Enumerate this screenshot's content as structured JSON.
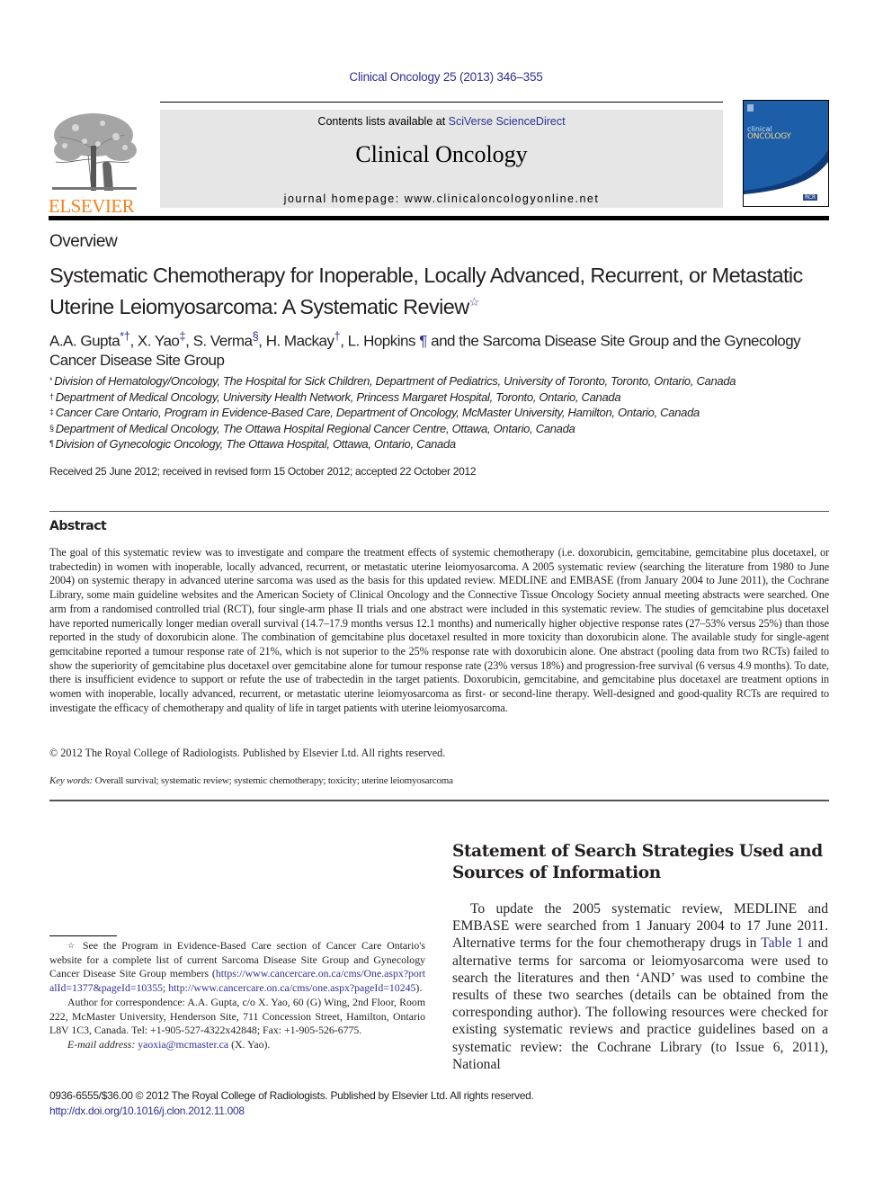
{
  "header": {
    "citation": "Clinical Oncology 25 (2013) 346–355",
    "contents_prefix": "Contents lists available at ",
    "contents_link": "SciVerse ScienceDirect",
    "journal_name": "Clinical Oncology",
    "homepage_label": "journal homepage: ",
    "homepage_url": "www.clinicaloncologyonline.net",
    "publisher_logo_text": "ELSEVIER",
    "cover": {
      "line1": "clinical",
      "line2": "ONCOLOGY",
      "badge": "RCR"
    }
  },
  "article": {
    "type": "Overview",
    "title": "Systematic Chemotherapy for Inoperable, Locally Advanced, Recurrent, or Metastatic Uterine Leiomyosarcoma: A Systematic Review",
    "title_mark": "☆",
    "authors": [
      {
        "name": "A.A. Gupta",
        "marks": "*†"
      },
      {
        "name": "X. Yao",
        "marks": "‡"
      },
      {
        "name": "S. Verma",
        "marks": "§"
      },
      {
        "name": "H. Mackay",
        "marks": "†"
      },
      {
        "name": "L. Hopkins",
        "marks": "¶"
      }
    ],
    "authors_tail": "and the Sarcoma Disease Site Group and the Gynecology Cancer Disease Site Group",
    "affiliations": [
      {
        "mark": "*",
        "text": "Division of Hematology/Oncology, The Hospital for Sick Children, Department of Pediatrics, University of Toronto, Toronto, Ontario, Canada"
      },
      {
        "mark": "†",
        "text": "Department of Medical Oncology, University Health Network, Princess Margaret Hospital, Toronto, Ontario, Canada"
      },
      {
        "mark": "‡",
        "text": "Cancer Care Ontario, Program in Evidence-Based Care, Department of Oncology, McMaster University, Hamilton, Ontario, Canada"
      },
      {
        "mark": "§",
        "text": "Department of Medical Oncology, The Ottawa Hospital Regional Cancer Centre, Ottawa, Ontario, Canada"
      },
      {
        "mark": "¶",
        "text": "Division of Gynecologic Oncology, The Ottawa Hospital, Ottawa, Ontario, Canada"
      }
    ],
    "received": "Received 25 June 2012; received in revised form 15 October 2012; accepted 22 October 2012"
  },
  "abstract": {
    "heading": "Abstract",
    "body": "The goal of this systematic review was to investigate and compare the treatment effects of systemic chemotherapy (i.e. doxorubicin, gemcitabine, gemcitabine plus docetaxel, or trabectedin) in women with inoperable, locally advanced, recurrent, or metastatic uterine leiomyosarcoma. A 2005 systematic review (searching the literature from 1980 to June 2004) on systemic therapy in advanced uterine sarcoma was used as the basis for this updated review. MEDLINE and EMBASE (from January 2004 to June 2011), the Cochrane Library, some main guideline websites and the American Society of Clinical Oncology and the Connective Tissue Oncology Society annual meeting abstracts were searched. One arm from a randomised controlled trial (RCT), four single-arm phase II trials and one abstract were included in this systematic review. The studies of gemcitabine plus docetaxel have reported numerically longer median overall survival (14.7–17.9 months versus 12.1 months) and numerically higher objective response rates (27–53% versus 25%) than those reported in the study of doxorubicin alone. The combination of gemcitabine plus docetaxel resulted in more toxicity than doxorubicin alone. The available study for single-agent gemcitabine reported a tumour response rate of 21%, which is not superior to the 25% response rate with doxorubicin alone. One abstract (pooling data from two RCTs) failed to show the superiority of gemcitabine plus docetaxel over gemcitabine alone for tumour response rate (23% versus 18%) and progression-free survival (6 versus 4.9 months). To date, there is insufficient evidence to support or refute the use of trabectedin in the target patients. Doxorubicin, gemcitabine, and gemcitabine plus docetaxel are treatment options in women with inoperable, locally advanced, recurrent, or metastatic uterine leiomyosarcoma as first- or second-line therapy. Well-designed and good-quality RCTs are required to investigate the efficacy of chemotherapy and quality of life in target patients with uterine leiomyosarcoma.",
    "copyright": "© 2012 The Royal College of Radiologists. Published by Elsevier Ltd. All rights reserved.",
    "keywords_label": "Key words:",
    "keywords": "Overall survival; systematic review; systemic chemotherapy; toxicity; uterine leiomyosarcoma"
  },
  "section": {
    "heading": "Statement of Search Strategies Used and Sources of Information",
    "para_before_link": "To update the 2005 systematic review, MEDLINE and EMBASE were searched from 1 January 2004 to 17 June 2011. Alternative terms for the four chemotherapy drugs in ",
    "table_link": "Table 1",
    "para_after_link": " and alternative terms for sarcoma or leiomyosarcoma were used to search the literatures and then ‘AND’ was used to combine the results of these two searches (details can be obtained from the corresponding author). The following resources were checked for existing systematic reviews and practice guidelines based on a systematic review: the Cochrane Library (to Issue 6, 2011), National"
  },
  "footnotes": {
    "star_mark": "☆",
    "star_text": "See the Program in Evidence-Based Care section of Cancer Care Ontario's website for a complete list of current Sarcoma Disease Site Group and Gynecology Cancer Disease Site Group members (",
    "link1": "https://www.cancercare.on.ca/cms/One.aspx?portalId=1377&pageId=10355",
    "sep": "; ",
    "link2": "http://www.cancercare.on.ca/cms/one.aspx?pageId=10245",
    "star_end": ").",
    "correspondence": "Author for correspondence: A.A. Gupta, c/o X. Yao, 60 (G) Wing, 2nd Floor, Room 222, McMaster University, Henderson Site, 711 Concession Street, Hamilton, Ontario L8V 1C3, Canada. Tel: +1-905-527-4322x42848; Fax: +1-905-526-6775.",
    "email_label": "E-mail address:",
    "email": "yaoxia@mcmaster.ca",
    "email_suffix": " (X. Yao)."
  },
  "footer": {
    "issn_line": "0936-6555/$36.00 © 2012 The Royal College of Radiologists. Published by Elsevier Ltd. All rights reserved.",
    "doi": "http://dx.doi.org/10.1016/j.clon.2012.11.008"
  }
}
